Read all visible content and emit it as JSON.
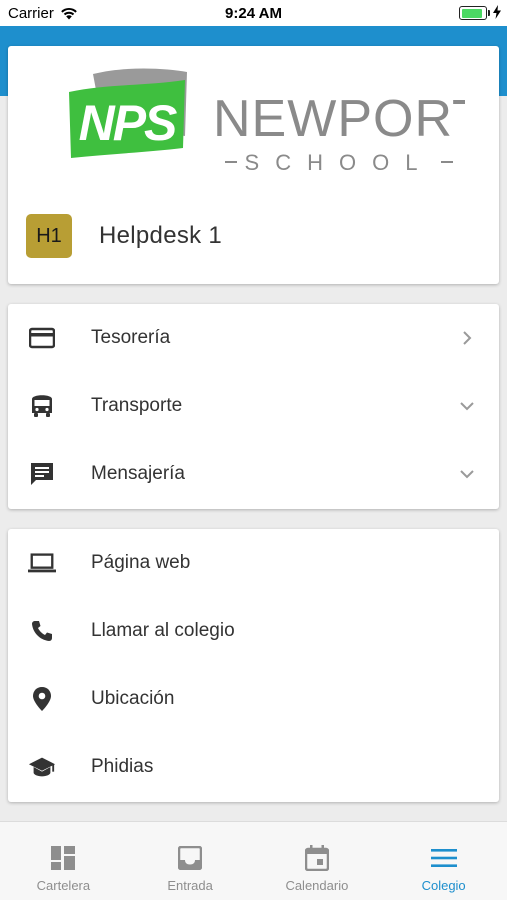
{
  "status_bar": {
    "carrier": "Carrier",
    "time": "9:24 AM",
    "battery_level": 0.9
  },
  "colors": {
    "brand_blue": "#1e8fcd",
    "logo_green": "#3fbf3f",
    "badge_gold": "#b89e34",
    "icon_dark": "#333333"
  },
  "school": {
    "logo_initials": "NPS",
    "logo_name": "NEWPORT",
    "logo_subtitle": "SCHOOL",
    "user_badge": "H1",
    "user_name": "Helpdesk 1"
  },
  "menu": {
    "items": [
      {
        "label": "Tesorería",
        "icon": "credit-card-icon",
        "chevron": "chevron-right-icon"
      },
      {
        "label": "Transporte",
        "icon": "bus-icon",
        "chevron": "chevron-down-icon"
      },
      {
        "label": "Mensajería",
        "icon": "chat-icon",
        "chevron": "chevron-down-icon"
      }
    ]
  },
  "links": {
    "items": [
      {
        "label": "Página web",
        "icon": "laptop-icon"
      },
      {
        "label": "Llamar al colegio",
        "icon": "phone-icon"
      },
      {
        "label": "Ubicación",
        "icon": "location-pin-icon"
      },
      {
        "label": "Phidias",
        "icon": "graduation-cap-icon"
      }
    ]
  },
  "tabs": [
    {
      "label": "Cartelera",
      "icon": "dashboard-icon",
      "active": false
    },
    {
      "label": "Entrada",
      "icon": "inbox-icon",
      "active": false
    },
    {
      "label": "Calendario",
      "icon": "calendar-icon",
      "active": false
    },
    {
      "label": "Colegio",
      "icon": "menu-icon",
      "active": true
    }
  ]
}
